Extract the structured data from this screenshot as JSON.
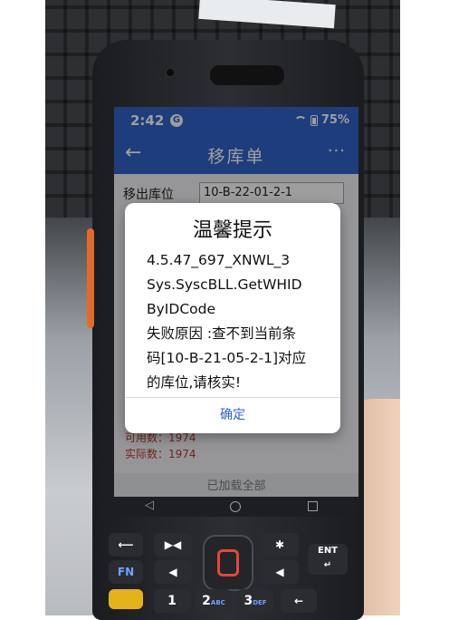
{
  "status_bar": {
    "time": "2:42",
    "app_badge": "G",
    "battery": "75%"
  },
  "app_bar": {
    "title": "移库单",
    "back_icon": "back-arrow-icon",
    "more_icon": "more-dots-icon"
  },
  "form": {
    "move_out_label": "移出库位",
    "move_out_value": "10-B-22-01-2-1"
  },
  "stats": {
    "available": "可用数：1974",
    "actual": "实际数：1974"
  },
  "bottom_button": "已加载全部",
  "dialog": {
    "title": "温馨提示",
    "lines": [
      "4.5.47_697_XNWL_3",
      "Sys.SyscBLL.GetWHID",
      "ByIDCode",
      "失败原因 :查不到当前条",
      "码[10-B-21-05-2-1]对应",
      "的库位,请核实!"
    ],
    "ok_label": "确定"
  },
  "keypad": {
    "fn_label": "FN",
    "ent_label": "ENT",
    "key_1": "1",
    "key_2": "2",
    "key_2_sub": "ABC",
    "key_3": "3",
    "key_3_sub": "DEF"
  },
  "colors": {
    "accent": "#2f63c9",
    "scan": "#e4473b",
    "side_button": "#e46a2a"
  }
}
